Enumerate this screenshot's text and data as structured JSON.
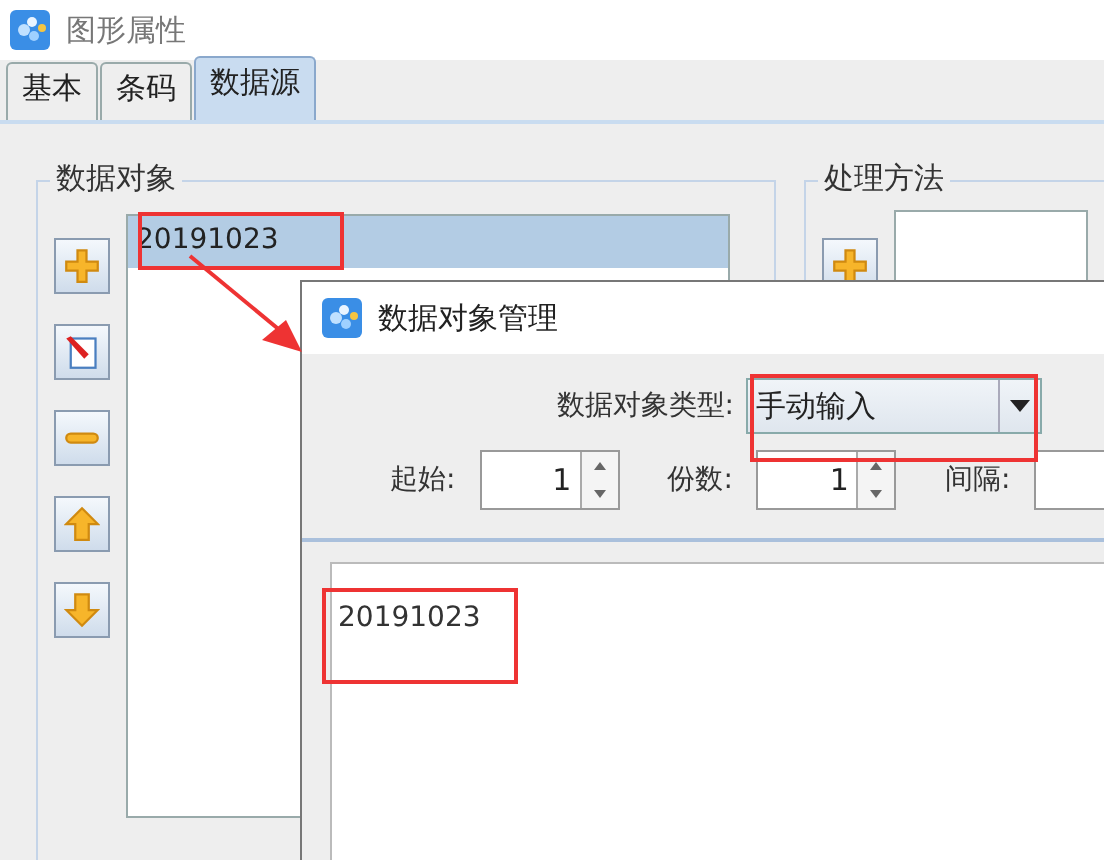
{
  "window": {
    "title": "图形属性"
  },
  "tabs": [
    {
      "label": "基本",
      "selected": false
    },
    {
      "label": "条码",
      "selected": false
    },
    {
      "label": "数据源",
      "selected": true
    }
  ],
  "data_objects": {
    "title": "数据对象",
    "items": [
      {
        "text": "20191023",
        "selected": true
      }
    ]
  },
  "processing": {
    "title": "处理方法"
  },
  "dialog": {
    "title": "数据对象管理",
    "type_label": "数据对象类型:",
    "type_value": "手动输入",
    "spinners": [
      {
        "label": "起始:",
        "value": "1"
      },
      {
        "label": "份数:",
        "value": "1"
      },
      {
        "label": "间隔:"
      }
    ],
    "content": "20191023"
  }
}
